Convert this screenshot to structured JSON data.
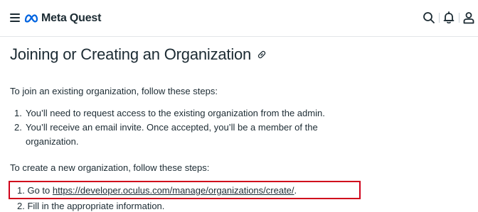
{
  "header": {
    "brand": "Meta Quest",
    "icons": [
      "menu-icon",
      "meta-logo-icon",
      "search-icon",
      "bell-icon",
      "user-icon"
    ]
  },
  "article": {
    "title": "Joining or Creating an Organization",
    "join_intro": "To join an existing organization, follow these steps:",
    "join_steps": [
      "You’ll need to request access to the existing organization from the admin.",
      "You’ll receive an email invite. Once accepted, you’ll be a member of the",
      "organization."
    ],
    "create_intro": "To create a new organization, follow these steps:",
    "create_step1_prefix": "1. Go to ",
    "create_step1_link": "https://developer.oculus.com/manage/organizations/create/",
    "create_step1_suffix": ".",
    "create_step2": "2. Fill in the appropriate information."
  },
  "colors": {
    "text": "#1c2b33",
    "highlight_border": "#d0021b",
    "meta_blue": "#0064e0"
  }
}
